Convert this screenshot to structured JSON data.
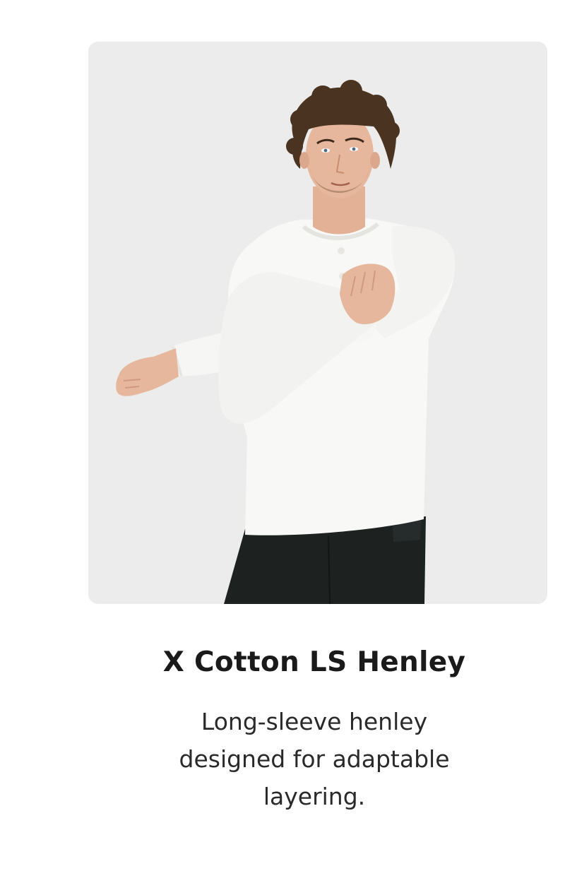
{
  "product": {
    "title": "X Cotton LS Henley",
    "description": "Long-sleeve henley designed for adaptable layering."
  },
  "image": {
    "background_color": "#ececec",
    "shirt_color": "#f8f8f6",
    "pants_color": "#1d2221",
    "hair_color": "#4a3321",
    "skin_color": "#e6b79c"
  }
}
